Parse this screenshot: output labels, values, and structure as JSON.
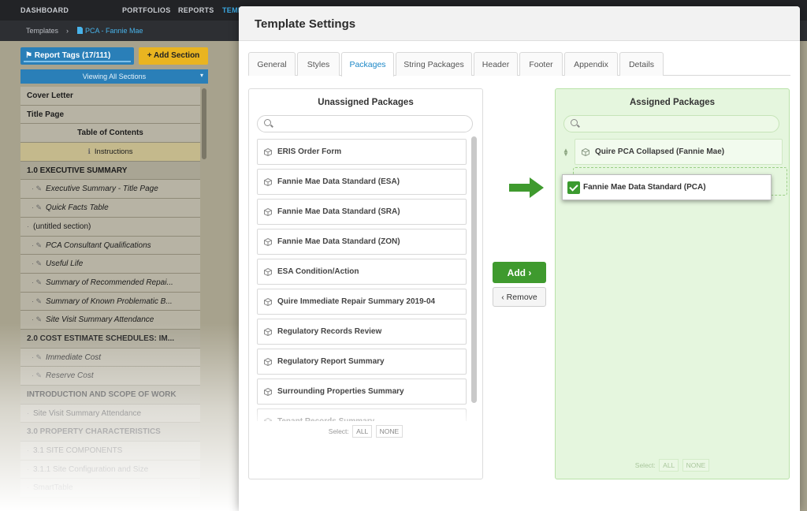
{
  "app": {
    "nav": [
      "DASHBOARD",
      "PORTFOLIOS",
      "REPORTS",
      "TEMP"
    ],
    "breadcrumb": {
      "root": "Templates",
      "separator": "›",
      "current": "PCA - Fannie Mae"
    }
  },
  "sidebar": {
    "report_tags_label": "Report Tags (17/111)",
    "add_section_label": "+ Add Section",
    "viewing_label": "Viewing All Sections",
    "viewing_caret": "▾",
    "outline": [
      {
        "text": "Cover Letter",
        "style": "bold"
      },
      {
        "text": "Title Page",
        "style": "bold"
      },
      {
        "text": "Table of Contents",
        "style": "center"
      },
      {
        "text": "Instructions",
        "style": "instr"
      },
      {
        "text": "1.0 EXECUTIVE SUMMARY",
        "style": "head"
      },
      {
        "text": "Executive Summary - Title Page",
        "style": "item"
      },
      {
        "text": "Quick Facts Table",
        "style": "item"
      },
      {
        "text": "(untitled section)",
        "style": "plain"
      },
      {
        "text": "PCA Consultant Qualifications",
        "style": "item"
      },
      {
        "text": "Useful Life",
        "style": "item"
      },
      {
        "text": "Summary of Recommended Repai...",
        "style": "item"
      },
      {
        "text": "Summary of Known Problematic B...",
        "style": "item"
      },
      {
        "text": "Site Visit Summary Attendance",
        "style": "item"
      },
      {
        "text": "2.0 COST ESTIMATE SCHEDULES: IM...",
        "style": "head"
      },
      {
        "text": "Immediate Cost",
        "style": "item"
      },
      {
        "text": "Reserve Cost",
        "style": "item"
      },
      {
        "text": "INTRODUCTION AND SCOPE OF WORK",
        "style": "head"
      },
      {
        "text": "Site Visit Summary Attendance",
        "style": "plain"
      },
      {
        "text": "3.0 PROPERTY CHARACTERISTICS",
        "style": "head"
      },
      {
        "text": "3.1 SITE COMPONENTS",
        "style": "plain"
      },
      {
        "text": "3.1.1 Site Configuration and Size",
        "style": "plain"
      },
      {
        "text": "SmartTable",
        "style": "plain"
      }
    ]
  },
  "modal": {
    "title": "Template Settings",
    "tabs": [
      "General",
      "Styles",
      "Packages",
      "String Packages",
      "Header",
      "Footer",
      "Appendix",
      "Details"
    ],
    "active_tab": "Packages",
    "unassigned": {
      "title": "Unassigned Packages",
      "search_placeholder": "",
      "items": [
        "ERIS Order Form",
        "Fannie Mae Data Standard (ESA)",
        "Fannie Mae Data Standard (SRA)",
        "Fannie Mae Data Standard (ZON)",
        "ESA Condition/Action",
        "Quire Immediate Repair Summary 2019-04",
        "Regulatory Records Review",
        "Regulatory Report Summary",
        "Surrounding Properties Summary",
        "Tenant Records Summary"
      ],
      "select_label": "Select:",
      "select_all": "ALL",
      "select_none": "NONE"
    },
    "assigned": {
      "title": "Assigned Packages",
      "search_placeholder": "",
      "items": [
        "Quire PCA Collapsed (Fannie Mae)"
      ],
      "dragging_item": "Fannie Mae Data Standard (PCA)",
      "select_label": "Select:",
      "select_all": "ALL",
      "select_none": "NONE"
    },
    "add_label": "Add ›",
    "remove_label": "‹ Remove"
  },
  "colors": {
    "accent_blue": "#1d88c7",
    "green": "#3f9a2e",
    "assigned_bg": "#e5f6de"
  },
  "icons": [
    "tag-icon",
    "info-icon",
    "document-icon",
    "package-cube-icon",
    "search-icon",
    "drag-handle-icon",
    "checkbox-checked-icon",
    "right-arrow-icon"
  ]
}
